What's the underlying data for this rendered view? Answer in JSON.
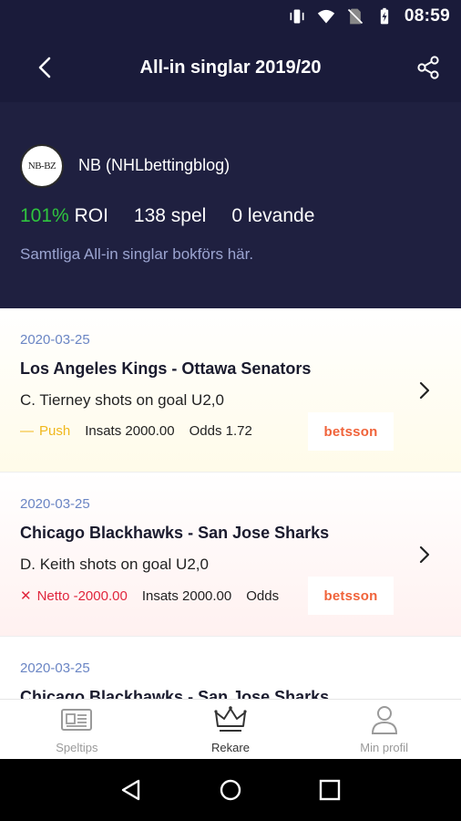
{
  "status_bar": {
    "time": "08:59"
  },
  "app_bar": {
    "title": "All-in singlar 2019/20"
  },
  "profile": {
    "avatar_text": "NB-BZ",
    "name": "NB (NHLbettingblog)",
    "roi_value": "101%",
    "roi_label": "ROI",
    "games": "138 spel",
    "live": "0 levande",
    "description": "Samtliga All-in singlar bokförs här."
  },
  "bets": [
    {
      "date": "2020-03-25",
      "match": "Los Angeles Kings - Ottawa Senators",
      "pick": "C. Tierney shots on goal U2,0",
      "status_symbol": "—",
      "status_text": "Push",
      "stake": "Insats 2000.00",
      "odds": "Odds 1.72",
      "bookmaker": "betsson"
    },
    {
      "date": "2020-03-25",
      "match": "Chicago Blackhawks - San Jose Sharks",
      "pick": "D. Keith shots on goal U2,0",
      "status_symbol": "✕",
      "status_text": "Netto -2000.00",
      "stake": "Insats 2000.00",
      "odds": "Odds",
      "bookmaker": "betsson"
    },
    {
      "date": "2020-03-25",
      "match": "Chicago Blackhawks - San Jose Sharks"
    }
  ],
  "bottom_nav": [
    {
      "label": "Speltips",
      "icon": "newspaper-icon"
    },
    {
      "label": "Rekare",
      "icon": "crown-icon"
    },
    {
      "label": "Min profil",
      "icon": "person-icon"
    }
  ],
  "colors": {
    "header_bg": "#1a1b3a",
    "profile_bg": "#1f2040",
    "roi_green": "#2fc43e",
    "push_yellow": "#f0b81e",
    "loss_red": "#e0263d",
    "date_blue": "#6a85c4",
    "brand_orange": "#f0633a"
  }
}
